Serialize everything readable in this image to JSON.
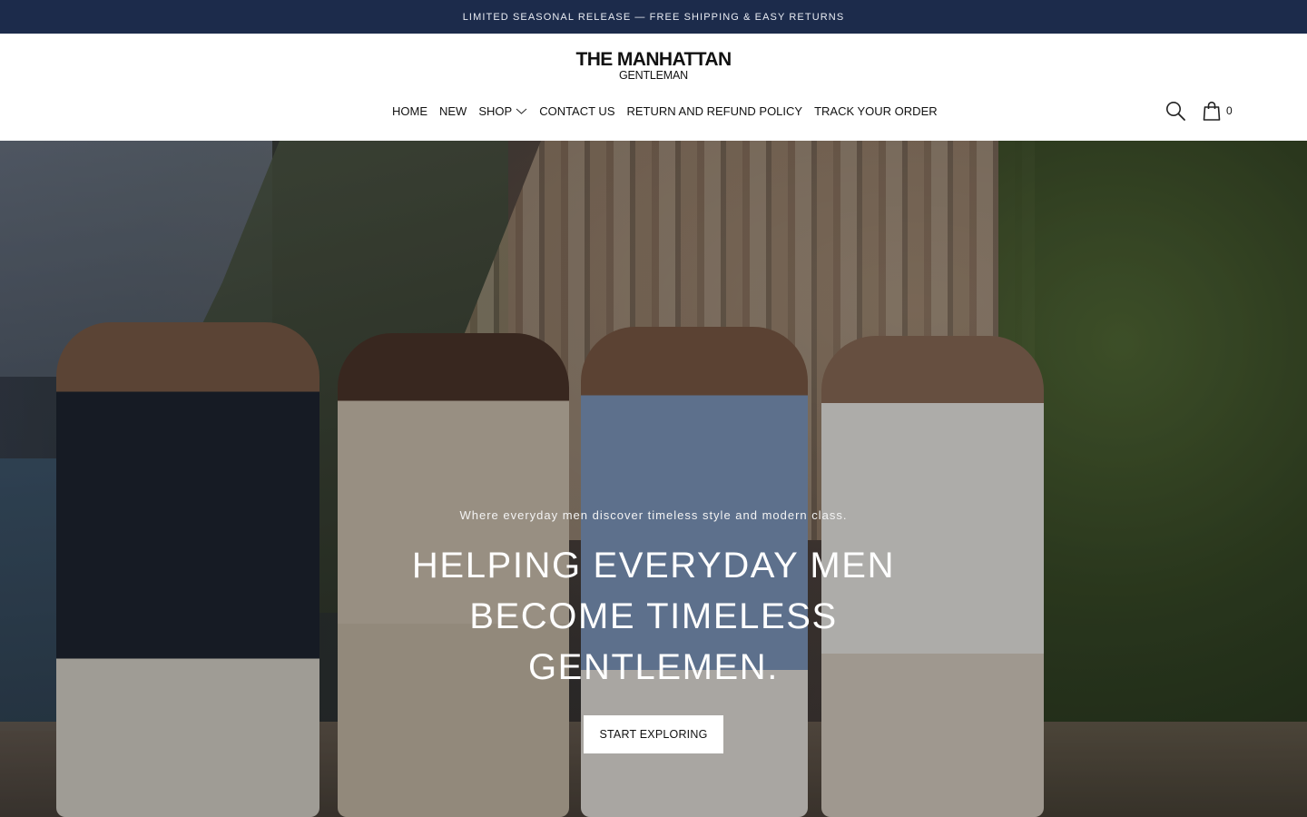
{
  "announcement": {
    "text": "LIMITED SEASONAL RELEASE — FREE SHIPPING & EASY RETURNS"
  },
  "header": {
    "logo": {
      "main": "THE MANHATTAN",
      "sub": "GENTLEMAN"
    },
    "nav": [
      {
        "label": "HOME"
      },
      {
        "label": "NEW"
      },
      {
        "label": "SHOP",
        "has_dropdown": true,
        "icon": "chevron-down-icon"
      },
      {
        "label": "CONTACT US"
      },
      {
        "label": "RETURN AND REFUND POLICY"
      },
      {
        "label": "TRACK YOUR ORDER"
      }
    ],
    "search_icon": "search-icon",
    "cart": {
      "icon": "shopping-bag-icon",
      "count": "0"
    }
  },
  "hero": {
    "tagline": "Where everyday men discover timeless style and modern class.",
    "title_lines": [
      "HELPING EVERYDAY MEN",
      "BECOME TIMELESS",
      "GENTLEMEN."
    ],
    "cta_label": "START EXPLORING"
  },
  "colors": {
    "announcement_bg": "#1c2b4b",
    "announcement_text": "#e9ecf3",
    "header_bg": "#ffffff",
    "cta_bg": "#ffffff"
  }
}
